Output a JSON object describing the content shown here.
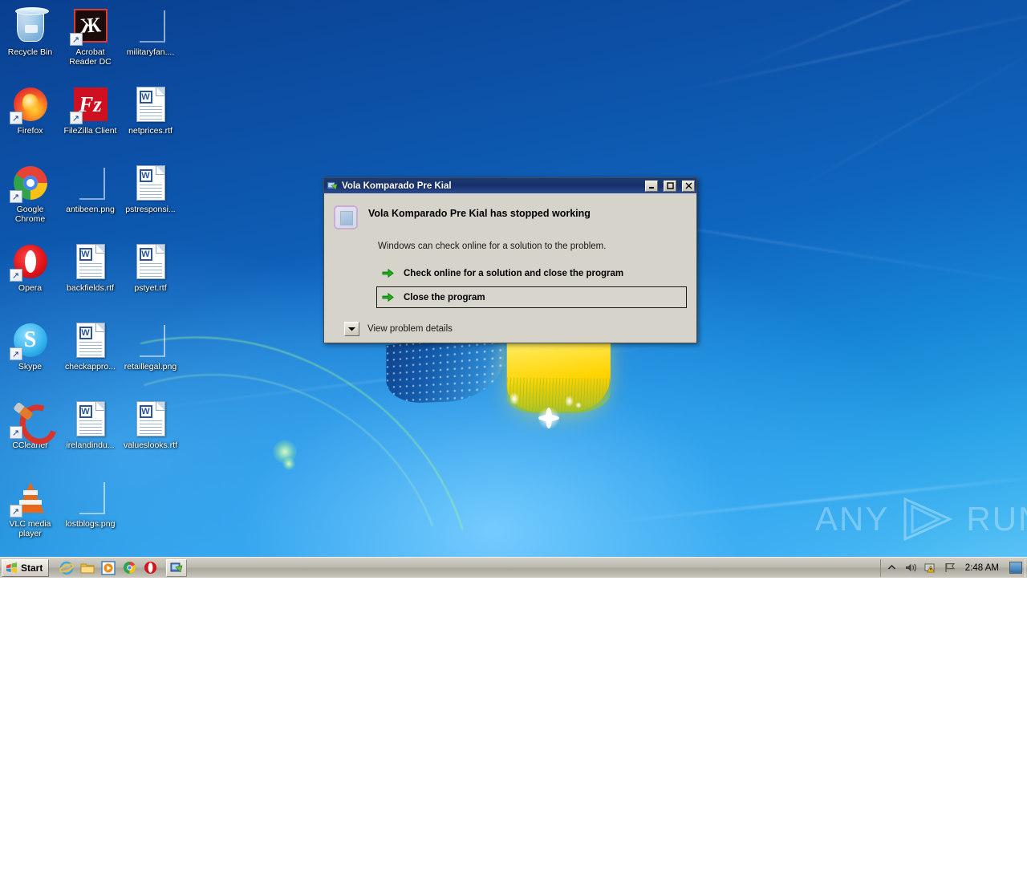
{
  "desktop": {
    "icons": [
      {
        "label": "Recycle Bin",
        "art": "recycle",
        "shortcut": false
      },
      {
        "label": "Acrobat Reader DC",
        "art": "acrobat",
        "shortcut": true
      },
      {
        "label": "militaryfan....",
        "art": "png",
        "shortcut": false
      },
      {
        "label": "Firefox",
        "art": "firefox",
        "shortcut": true
      },
      {
        "label": "FileZilla Client",
        "art": "filezilla",
        "shortcut": true
      },
      {
        "label": "netprices.rtf",
        "art": "word",
        "shortcut": false
      },
      {
        "label": "Google Chrome",
        "art": "chrome",
        "shortcut": true
      },
      {
        "label": "antibeen.png",
        "art": "png",
        "shortcut": false
      },
      {
        "label": "pstresponsi...",
        "art": "word",
        "shortcut": false
      },
      {
        "label": "Opera",
        "art": "opera",
        "shortcut": true
      },
      {
        "label": "backfields.rtf",
        "art": "word",
        "shortcut": false
      },
      {
        "label": "pstyet.rtf",
        "art": "word",
        "shortcut": false
      },
      {
        "label": "Skype",
        "art": "skype",
        "shortcut": true
      },
      {
        "label": "checkappro...",
        "art": "word",
        "shortcut": false
      },
      {
        "label": "retaillegal.png",
        "art": "png",
        "shortcut": false
      },
      {
        "label": "CCleaner",
        "art": "ccleaner",
        "shortcut": true
      },
      {
        "label": "irelandindu...",
        "art": "word",
        "shortcut": false
      },
      {
        "label": "valueslooks.rtf",
        "art": "word",
        "shortcut": false
      },
      {
        "label": "VLC media player",
        "art": "vlc",
        "shortcut": true
      },
      {
        "label": "lostblogs.png",
        "art": "png",
        "shortcut": false
      }
    ],
    "watermark": {
      "left_text": "ANY",
      "right_text": "RUN",
      "logo": "play-triangle-icon"
    }
  },
  "dialog": {
    "title": "Vola Komparado Pre Kial",
    "title_icon": "crashed-program-icon",
    "headline": "Vola Komparado Pre Kial has stopped working",
    "subtext": "Windows can check online for a solution to the problem.",
    "options": [
      {
        "label": "Check online for a solution and close the program",
        "focused": false
      },
      {
        "label": "Close the program",
        "focused": true
      }
    ],
    "details_label": "View problem details",
    "titlebar_buttons": [
      {
        "name": "minimize",
        "glyph": "_"
      },
      {
        "name": "maximize",
        "glyph": "□"
      },
      {
        "name": "close",
        "glyph": "✕"
      }
    ],
    "colors": {
      "titlebar": "#1f3a73",
      "face": "#d6d3ca",
      "arrow": "#19b319"
    }
  },
  "taskbar": {
    "start_label": "Start",
    "quick_launch": [
      {
        "name": "internet-explorer-icon",
        "title": "Internet Explorer"
      },
      {
        "name": "windows-explorer-icon",
        "title": "Windows Explorer"
      },
      {
        "name": "media-player-icon",
        "title": "Windows Media Player"
      },
      {
        "name": "chrome-icon",
        "title": "Google Chrome"
      },
      {
        "name": "opera-icon",
        "title": "Opera"
      }
    ],
    "tasks": [
      {
        "name": "vola-komparado-task",
        "icon": "crashed-program-icon",
        "active": true
      }
    ],
    "tray": [
      {
        "name": "show-hidden-icons-icon",
        "glyph": "⌃"
      },
      {
        "name": "volume-icon",
        "glyph": "🔊"
      },
      {
        "name": "network-warning-icon",
        "glyph": "▤"
      },
      {
        "name": "action-center-flag-icon",
        "glyph": "⚑"
      }
    ],
    "clock": "2:48 AM",
    "show_desktop": "show-desktop-button"
  }
}
